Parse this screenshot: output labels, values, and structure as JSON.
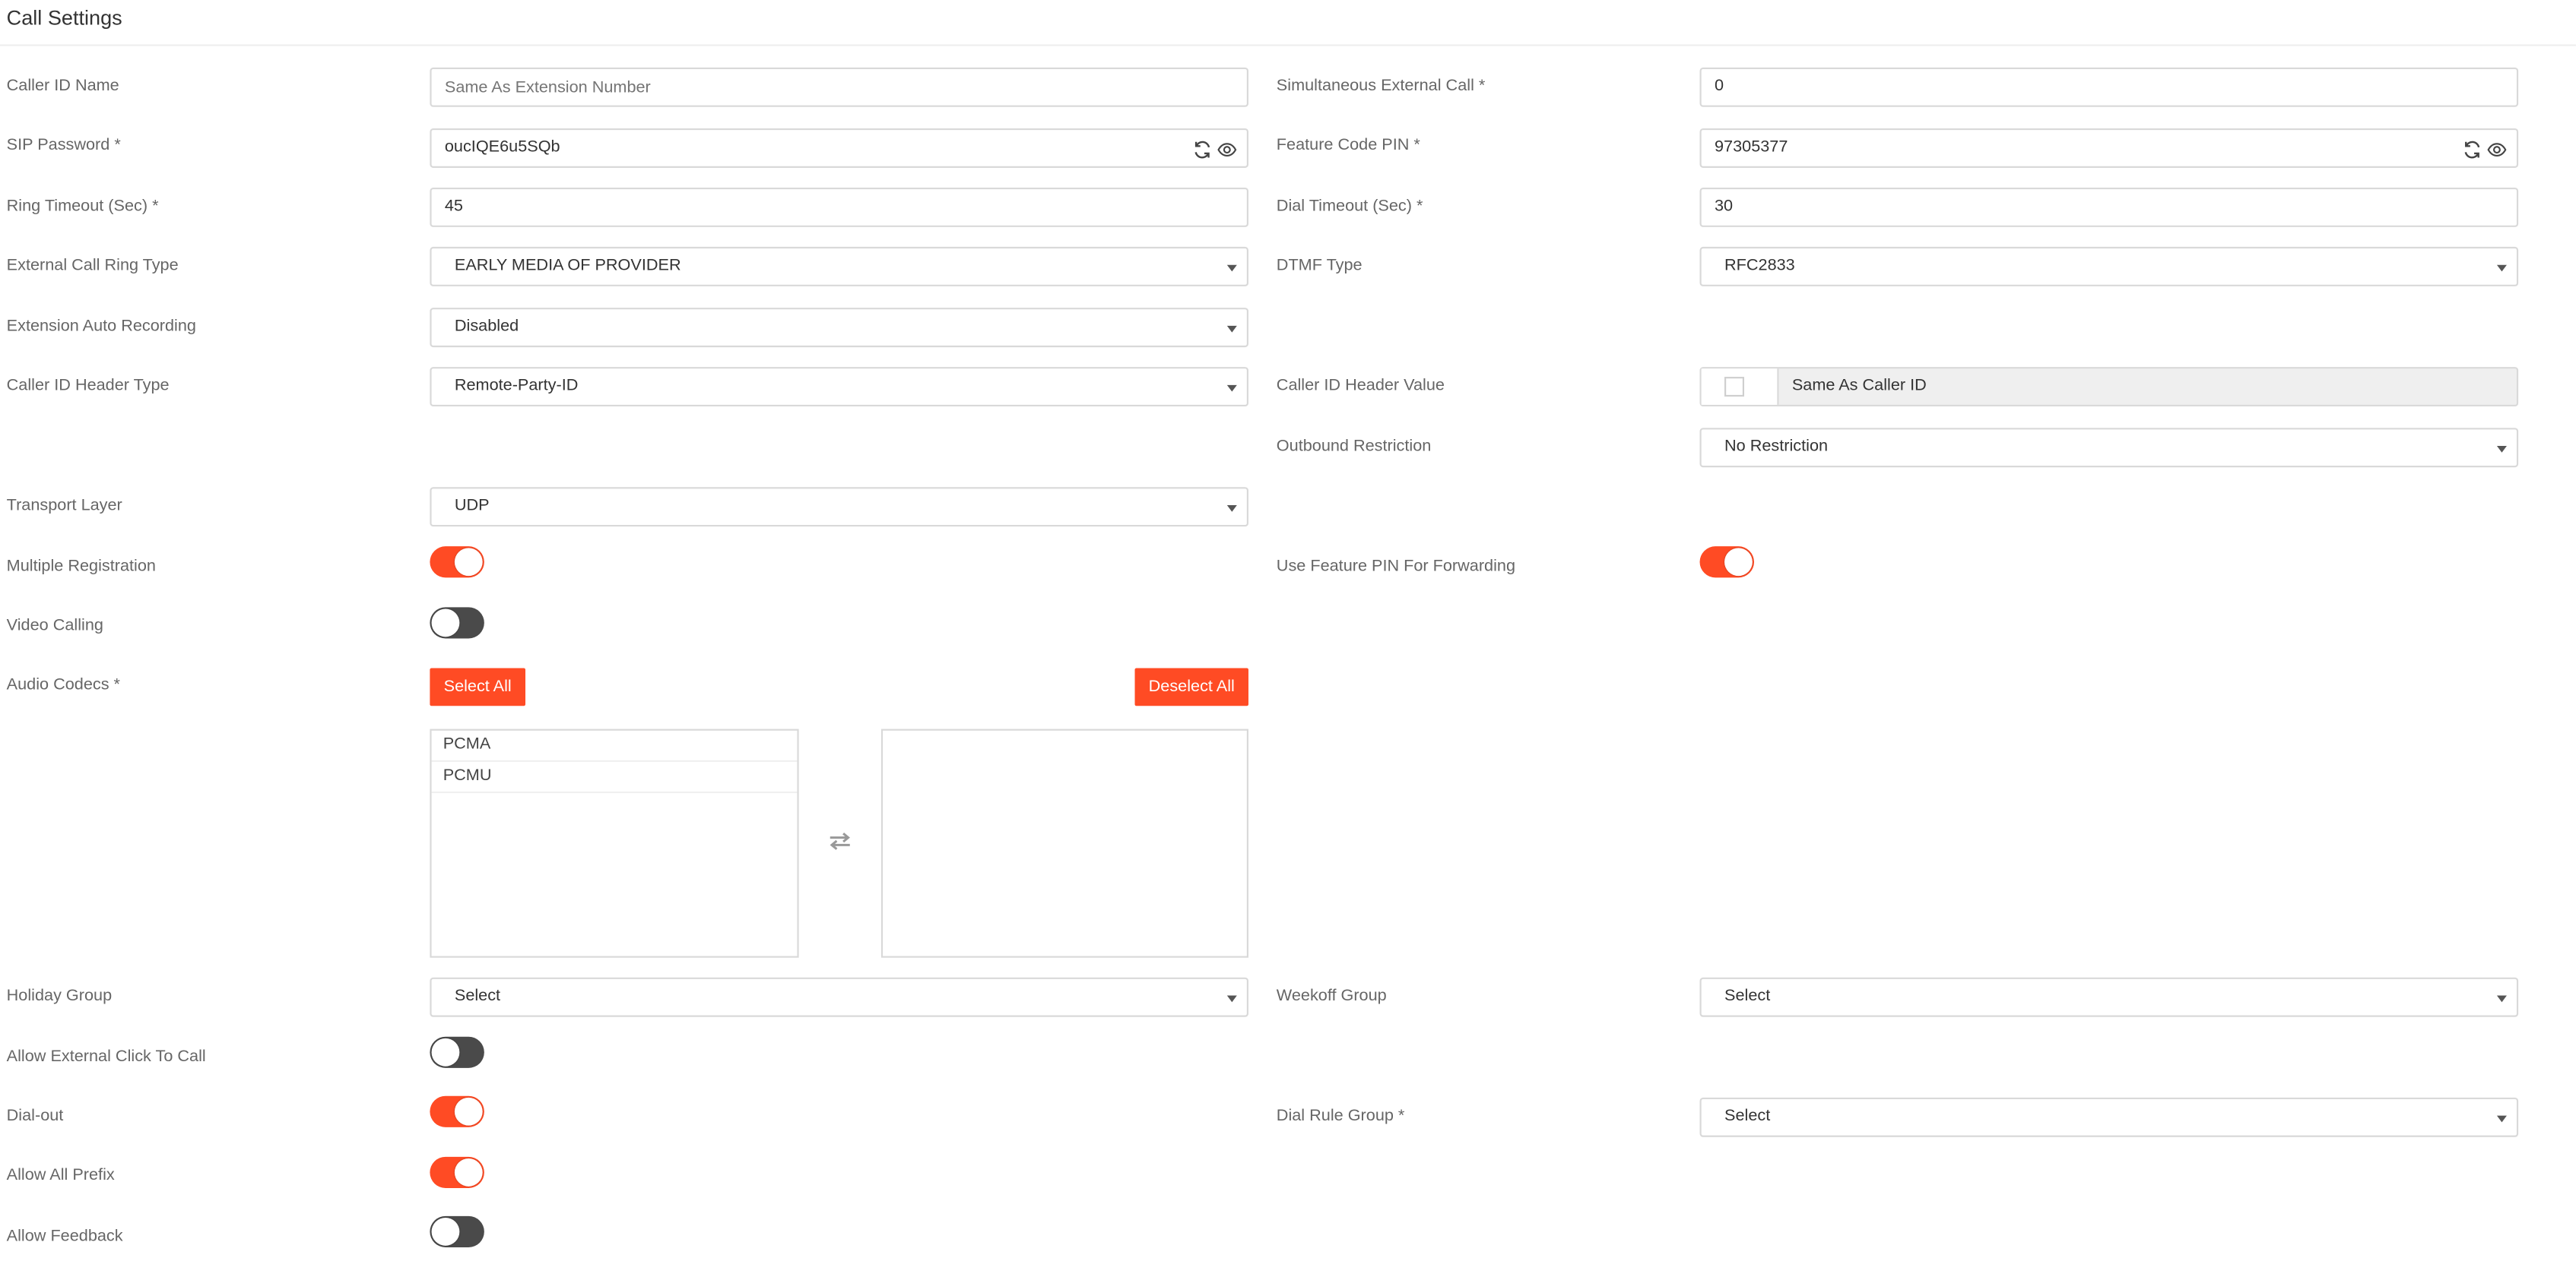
{
  "page": {
    "title": "Call Settings"
  },
  "caller_id_name": {
    "label": "Caller ID Name",
    "placeholder": "Same As Extension Number"
  },
  "sip_password": {
    "label": "SIP Password *",
    "value": "oucIQE6u5SQb"
  },
  "ring_timeout": {
    "label": "Ring Timeout (Sec) *",
    "value": "45"
  },
  "external_call_ring_type": {
    "label": "External Call Ring Type",
    "value": "EARLY MEDIA OF PROVIDER"
  },
  "extension_auto_recording": {
    "label": "Extension Auto Recording",
    "value": "Disabled"
  },
  "caller_id_header_type": {
    "label": "Caller ID Header Type",
    "value": "Remote-Party-ID"
  },
  "transport_layer": {
    "label": "Transport Layer",
    "value": "UDP"
  },
  "multiple_registration": {
    "label": "Multiple Registration",
    "enabled": true
  },
  "video_calling": {
    "label": "Video Calling",
    "enabled": false
  },
  "audio_codecs": {
    "label": "Audio Codecs *",
    "select_all": "Select All",
    "deselect_all": "Deselect All",
    "available": [
      "PCMA",
      "PCMU"
    ],
    "selected": []
  },
  "holiday_group": {
    "label": "Holiday Group",
    "value": "Select"
  },
  "allow_external_click_to_call": {
    "label": "Allow External Click To Call",
    "enabled": false
  },
  "dial_out": {
    "label": "Dial-out",
    "enabled": true
  },
  "allow_all_prefix": {
    "label": "Allow All Prefix",
    "enabled": true
  },
  "allow_feedback": {
    "label": "Allow Feedback",
    "enabled": false
  },
  "simultaneous_external_call": {
    "label": "Simultaneous External Call *",
    "value": "0"
  },
  "feature_code_pin": {
    "label": "Feature Code PIN *",
    "value": "97305377"
  },
  "dial_timeout": {
    "label": "Dial Timeout (Sec) *",
    "value": "30"
  },
  "dtmf_type": {
    "label": "DTMF Type",
    "value": "RFC2833"
  },
  "caller_id_header_value": {
    "label": "Caller ID Header Value",
    "checkbox_label": "Same As Caller ID",
    "checked": false
  },
  "outbound_restriction": {
    "label": "Outbound Restriction",
    "value": "No Restriction"
  },
  "use_feature_pin_for_forwarding": {
    "label": "Use Feature PIN For Forwarding",
    "enabled": true
  },
  "weekoff_group": {
    "label": "Weekoff Group",
    "value": "Select"
  },
  "dial_rule_group": {
    "label": "Dial Rule Group *",
    "value": "Select"
  },
  "colors": {
    "accent": "#ff4b24",
    "toggle_off": "#4a4a4a",
    "border": "#d9d9d9"
  },
  "icons": {
    "refresh": "refresh-icon",
    "eye": "eye-icon",
    "swap": "swap-arrows-icon",
    "caret": "chevron-down-icon"
  }
}
